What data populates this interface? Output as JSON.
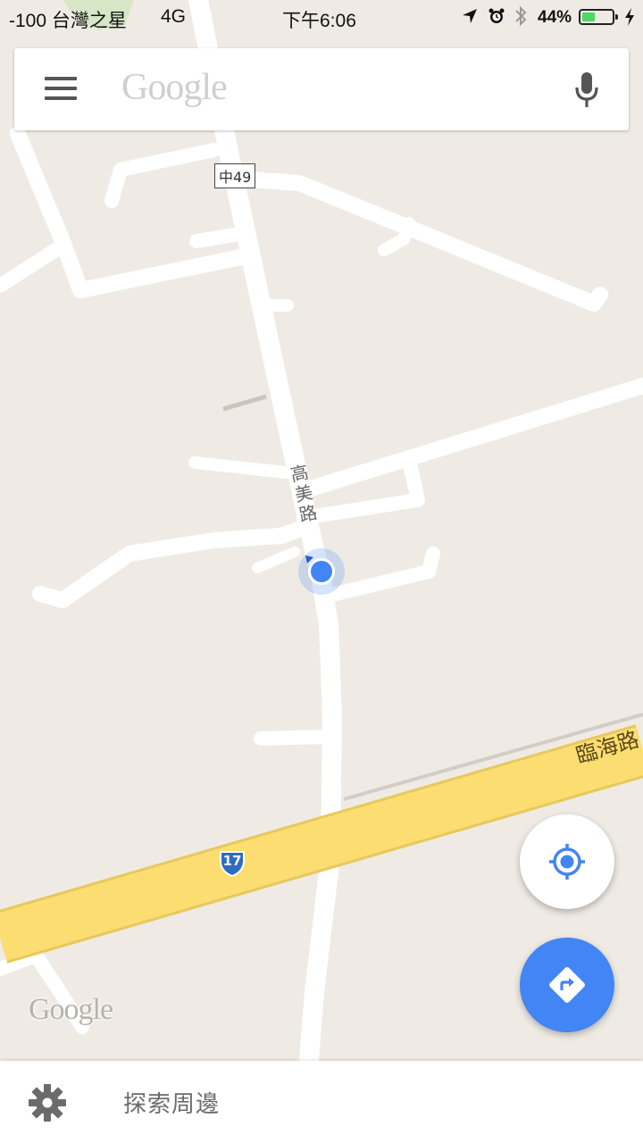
{
  "status_bar": {
    "carrier": "-100 台灣之星",
    "network": "4G",
    "time": "下午6:06",
    "battery_text": "44%",
    "battery_level": 0.44,
    "battery_color": "#4cd964"
  },
  "search_bar": {
    "menu_icon": "hamburger-menu-icon",
    "placeholder_logo": "Google",
    "mic_icon": "microphone-icon"
  },
  "map": {
    "road_labels": {
      "county_route": "中49",
      "main_street": "高美路",
      "highway_name": "臨海路",
      "highway_shield": "17"
    },
    "watermark": "Google",
    "colors": {
      "land": "#efebe4",
      "road": "#ffffff",
      "highway": "#fcdd71",
      "location_dot": "#4285f4",
      "shield": "#2f6bbf"
    }
  },
  "buttons": {
    "my_location_icon": "my-location-icon",
    "directions_icon": "directions-icon"
  },
  "bottom_bar": {
    "settings_icon": "gear-icon",
    "explore_label": "探索周邊"
  }
}
